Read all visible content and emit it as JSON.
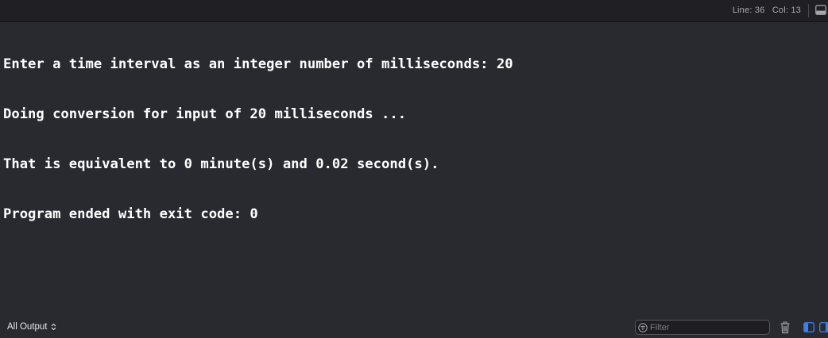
{
  "status": {
    "line_label": "Line: 36",
    "col_label": "Col: 13"
  },
  "console": {
    "lines": [
      "Enter a time interval as an integer number of milliseconds: 20",
      "Doing conversion for input of 20 milliseconds ...",
      "That is equivalent to 0 minute(s) and 0.02 second(s).",
      "Program ended with exit code: 0"
    ]
  },
  "bottom": {
    "scope_label": "All Output",
    "scope_icon": "chevron-up-down-icon",
    "filter_placeholder": "Filter",
    "filter_icon": "filter-icon",
    "trash_icon": "trash-icon",
    "left_pane_icon": "left-pane-icon",
    "right_pane_icon": "right-pane-icon"
  },
  "colors": {
    "background": "#292a30",
    "text": "#ffffff",
    "accent": "#3b82f6"
  }
}
